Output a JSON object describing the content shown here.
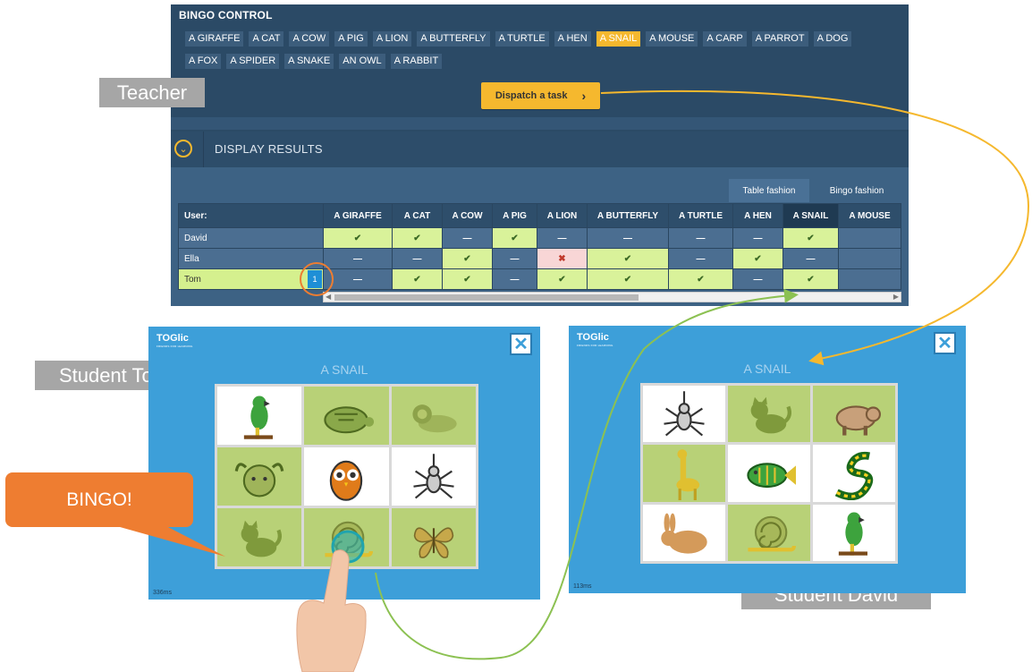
{
  "teacher": {
    "title": "BINGO CONTROL",
    "words_row1": [
      "A GIRAFFE",
      "A CAT",
      "A COW",
      "A PIG",
      "A LION",
      "A BUTTERFLY",
      "A TURTLE",
      "A HEN",
      "A SNAIL",
      "A MOUSE",
      "A CARP",
      "A PARROT",
      "A DOG"
    ],
    "words_row2": [
      "A FOX",
      "A SPIDER",
      "A SNAKE",
      "AN OWL",
      "A RABBIT"
    ],
    "active_word": "A SNAIL",
    "dispatch_label": "Dispatch a task",
    "display_results_label": "DISPLAY RESULTS",
    "tabs": {
      "table": "Table fashion",
      "bingo": "Bingo fashion"
    },
    "table": {
      "user_header": "User:",
      "columns": [
        "A GIRAFFE",
        "A CAT",
        "A COW",
        "A PIG",
        "A LION",
        "A BUTTERFLY",
        "A TURTLE",
        "A HEN",
        "A SNAIL",
        "A MOUSE"
      ],
      "rows": [
        {
          "name": "David",
          "badge": "",
          "cells": [
            "yes",
            "yes",
            "no",
            "yes",
            "no",
            "no",
            "no",
            "no",
            "yes",
            ""
          ]
        },
        {
          "name": "Ella",
          "badge": "",
          "cells": [
            "no",
            "no",
            "yes",
            "no",
            "wrong",
            "yes",
            "no",
            "yes",
            "no",
            ""
          ]
        },
        {
          "name": "Tom",
          "badge": "1",
          "cells": [
            "no",
            "yes",
            "yes",
            "no",
            "yes",
            "yes",
            "yes",
            "no",
            "yes",
            ""
          ]
        }
      ]
    }
  },
  "labels": {
    "teacher": "Teacher",
    "student_tom": "Student Tom",
    "student_david": "Student David",
    "bingo": "BINGO!"
  },
  "student_tom": {
    "logo": "TOGlic",
    "task_word": "A SNAIL",
    "timing": "336ms",
    "cells": [
      {
        "icon": "parrot-icon",
        "bg": "w"
      },
      {
        "icon": "turtle-icon",
        "bg": "g"
      },
      {
        "icon": "lion-icon",
        "bg": "g"
      },
      {
        "icon": "goat-icon",
        "bg": "g"
      },
      {
        "icon": "owl-icon",
        "bg": "w"
      },
      {
        "icon": "spider-icon",
        "bg": "w"
      },
      {
        "icon": "cat-icon",
        "bg": "g"
      },
      {
        "icon": "snail-icon",
        "bg": "g"
      },
      {
        "icon": "butterfly-icon",
        "bg": "g"
      }
    ]
  },
  "student_david": {
    "logo": "TOGlic",
    "task_word": "A SNAIL",
    "timing": "113ms",
    "cells": [
      {
        "icon": "spider-icon",
        "bg": "w"
      },
      {
        "icon": "cat-icon",
        "bg": "g"
      },
      {
        "icon": "pig-icon",
        "bg": "g"
      },
      {
        "icon": "giraffe-icon",
        "bg": "g"
      },
      {
        "icon": "fish-icon",
        "bg": "w"
      },
      {
        "icon": "snake-icon",
        "bg": "w"
      },
      {
        "icon": "rabbit-icon",
        "bg": "w"
      },
      {
        "icon": "snail-icon",
        "bg": "g"
      },
      {
        "icon": "parrot-icon",
        "bg": "w"
      }
    ]
  },
  "colors": {
    "teacher_bg": "#2b4a66",
    "accent": "#f5b82e",
    "student_bg": "#3d9fd9",
    "correct": "#d9f29a",
    "wrong": "#f8d6d6",
    "bubble": "#ee7d31",
    "arrow_green": "#8cc152"
  }
}
